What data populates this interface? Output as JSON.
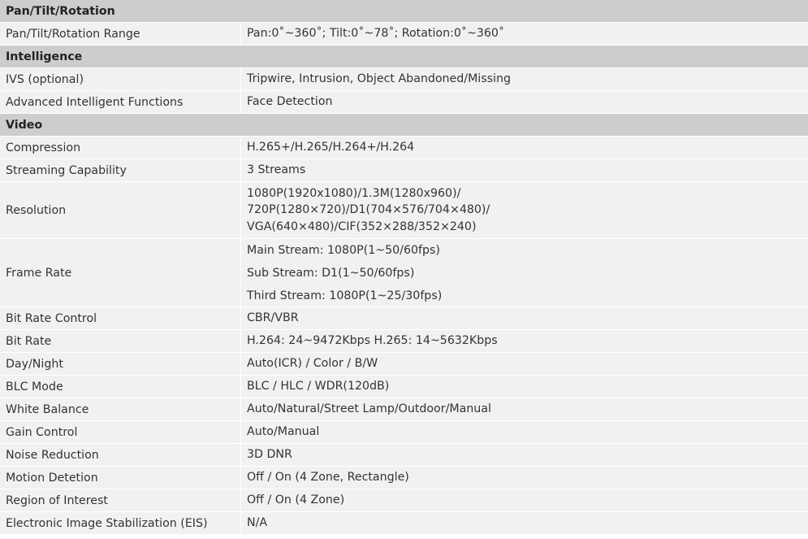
{
  "sections": [
    {
      "title": "Pan/Tilt/Rotation",
      "rows": [
        {
          "label": "Pan/Tilt/Rotation Range",
          "value": [
            "Pan:0˚~360˚; Tilt:0˚~78˚; Rotation:0˚~360˚"
          ]
        }
      ]
    },
    {
      "title": "Intelligence",
      "rows": [
        {
          "label": "IVS (optional)",
          "value": [
            "Tripwire, Intrusion, Object Abandoned/Missing"
          ]
        },
        {
          "label": "Advanced Intelligent Functions",
          "value": [
            "Face Detection"
          ]
        }
      ]
    },
    {
      "title": "Video",
      "rows": [
        {
          "label": "Compression",
          "value": [
            "H.265+/H.265/H.264+/H.264"
          ]
        },
        {
          "label": "Streaming Capability",
          "value": [
            "3 Streams"
          ]
        },
        {
          "label": "Resolution",
          "value": [
            "1080P(1920x1080)/1.3M(1280x960)/",
            "720P(1280×720)/D1(704×576/704×480)/",
            "VGA(640×480)/CIF(352×288/352×240)"
          ]
        },
        {
          "label": "Frame Rate",
          "value": [
            "Main Stream: 1080P(1~50/60fps)",
            "Sub Stream: D1(1~50/60fps)",
            "Third Stream: 1080P(1~25/30fps)"
          ]
        },
        {
          "label": "Bit Rate Control",
          "value": [
            "CBR/VBR"
          ]
        },
        {
          "label": "Bit Rate",
          "value": [
            "H.264: 24~9472Kbps H.265: 14~5632Kbps"
          ]
        },
        {
          "label": "Day/Night",
          "value": [
            "Auto(ICR) / Color / B/W"
          ]
        },
        {
          "label": "BLC Mode",
          "value": [
            "BLC / HLC / WDR(120dB)"
          ]
        },
        {
          "label": "White Balance",
          "value": [
            "Auto/Natural/Street Lamp/Outdoor/Manual"
          ]
        },
        {
          "label": "Gain Control",
          "value": [
            "Auto/Manual"
          ]
        },
        {
          "label": "Noise Reduction",
          "value": [
            "3D DNR"
          ]
        },
        {
          "label": "Motion Detetion",
          "value": [
            "Off / On (4 Zone, Rectangle)"
          ]
        },
        {
          "label": "Region of Interest",
          "value": [
            "Off / On (4 Zone)"
          ]
        },
        {
          "label": "Electronic Image Stabilization (EIS)",
          "value": [
            "N/A"
          ]
        }
      ]
    }
  ]
}
